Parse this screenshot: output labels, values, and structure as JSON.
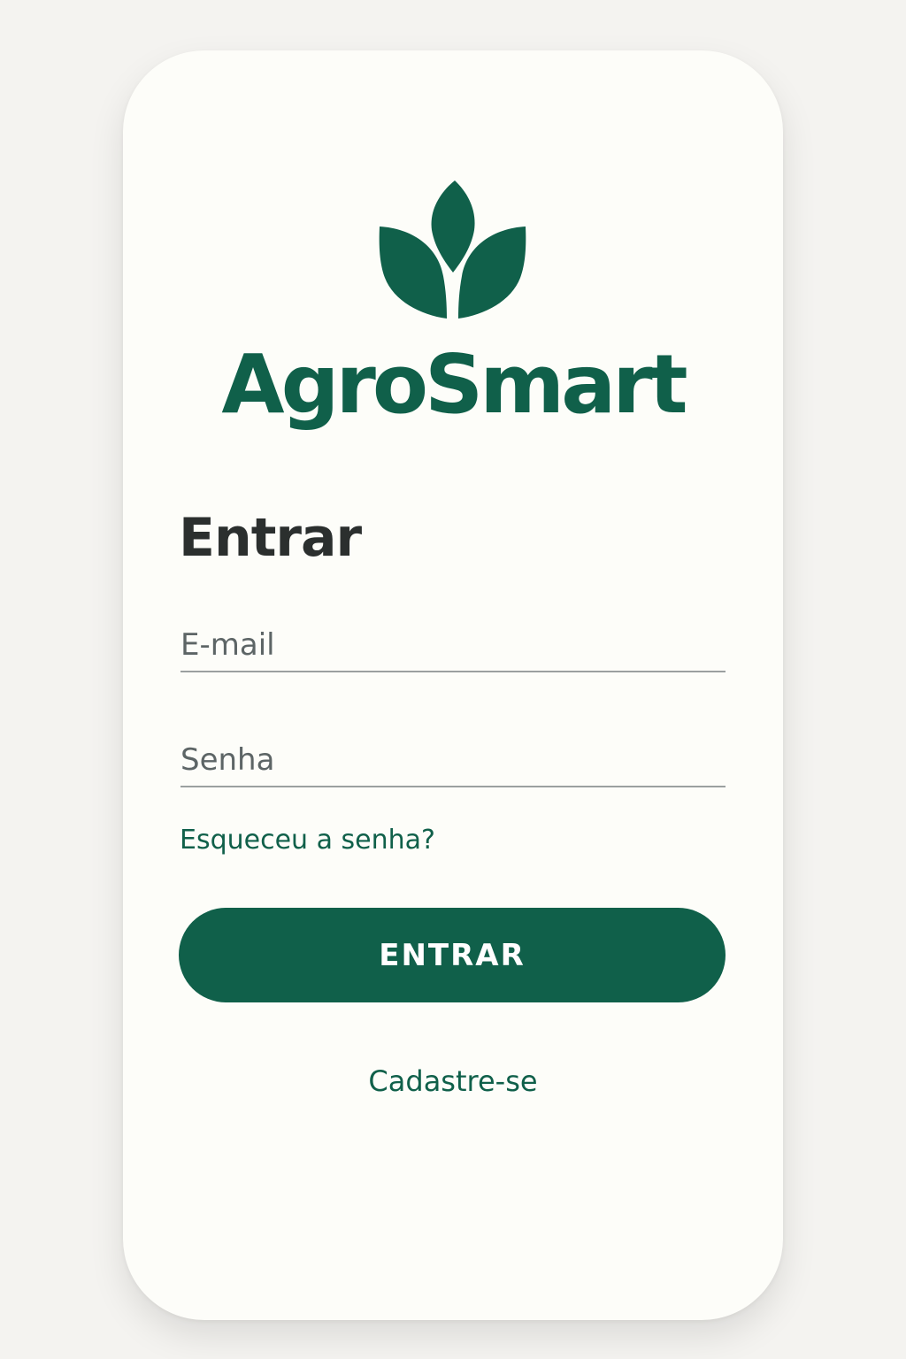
{
  "brand": {
    "name": "AgroSmart",
    "logo_icon": "leaf-sprout-icon",
    "color": "#10604a"
  },
  "login": {
    "title": "Entrar",
    "email_placeholder": "E-mail",
    "password_placeholder": "Senha",
    "forgot_password": "Esqueceu a senha?",
    "submit_label": "ENTRAR",
    "signup_link": "Cadastre-se"
  }
}
